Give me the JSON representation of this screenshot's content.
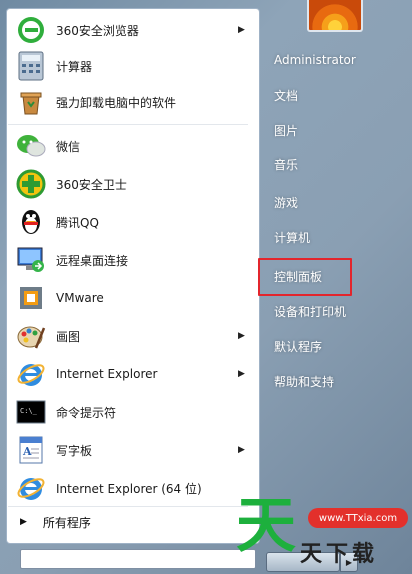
{
  "left_menu": {
    "items": [
      {
        "label": "360安全浏览器",
        "icon": "360-browser-icon",
        "has_arrow": true
      },
      {
        "label": "计算器",
        "icon": "calculator-icon",
        "has_arrow": false
      },
      {
        "label": "强力卸载电脑中的软件",
        "icon": "uninstall-icon",
        "has_arrow": false
      },
      {
        "label": "微信",
        "icon": "wechat-icon",
        "has_arrow": false
      },
      {
        "label": "360安全卫士",
        "icon": "360-guard-icon",
        "has_arrow": false
      },
      {
        "label": "腾讯QQ",
        "icon": "qq-penguin-icon",
        "has_arrow": false
      },
      {
        "label": "远程桌面连接",
        "icon": "remote-desktop-icon",
        "has_arrow": false
      },
      {
        "label": "VMware",
        "icon": "vmware-icon",
        "has_arrow": false
      },
      {
        "label": "画图",
        "icon": "paint-palette-icon",
        "has_arrow": true
      },
      {
        "label": "Internet Explorer",
        "icon": "ie-icon",
        "has_arrow": true
      },
      {
        "label": "命令提示符",
        "icon": "cmd-icon",
        "has_arrow": false
      },
      {
        "label": "写字板",
        "icon": "wordpad-icon",
        "has_arrow": true
      },
      {
        "label": "Internet Explorer (64 位)",
        "icon": "ie-icon",
        "has_arrow": false
      }
    ],
    "all_programs": "所有程序"
  },
  "right_menu": {
    "items": [
      "Administrator",
      "文档",
      "图片",
      "音乐",
      "游戏",
      "计算机",
      "控制面板",
      "设备和打印机",
      "默认程序",
      "帮助和支持"
    ],
    "highlighted": "控制面板"
  },
  "watermark": {
    "url": "www.TTxia.com",
    "brand": "天下载",
    "big_char": "天"
  },
  "colors": {
    "highlight_border": "#e3252c",
    "watermark_green": "#1db03d",
    "watermark_red": "#e3302b"
  }
}
